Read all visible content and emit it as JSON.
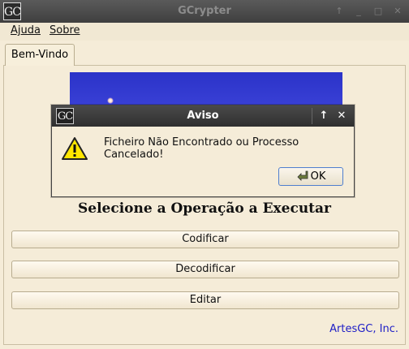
{
  "window": {
    "icon_text": "GC",
    "title": "GCrypter",
    "buttons": [
      "↑",
      "_",
      "□",
      "✕"
    ]
  },
  "menubar": {
    "items": [
      "Ajuda",
      "Sobre"
    ]
  },
  "tabs": [
    "Bem-Vindo"
  ],
  "main": {
    "heading": "Selecione a Operação a Executar",
    "buttons": [
      "Codificar",
      "Decodificar",
      "Editar"
    ],
    "footer": "ArtesGC, Inc."
  },
  "dialog": {
    "icon_text": "GC",
    "title": "Aviso",
    "message": "Ficheiro Não Encontrado ou Processo Cancelado!",
    "ok_label": "OK",
    "controls": [
      "↑",
      "✕"
    ]
  },
  "colors": {
    "banner": "#2b33c8",
    "footer_link": "#1d1dc6",
    "warning": "#ffe600"
  }
}
